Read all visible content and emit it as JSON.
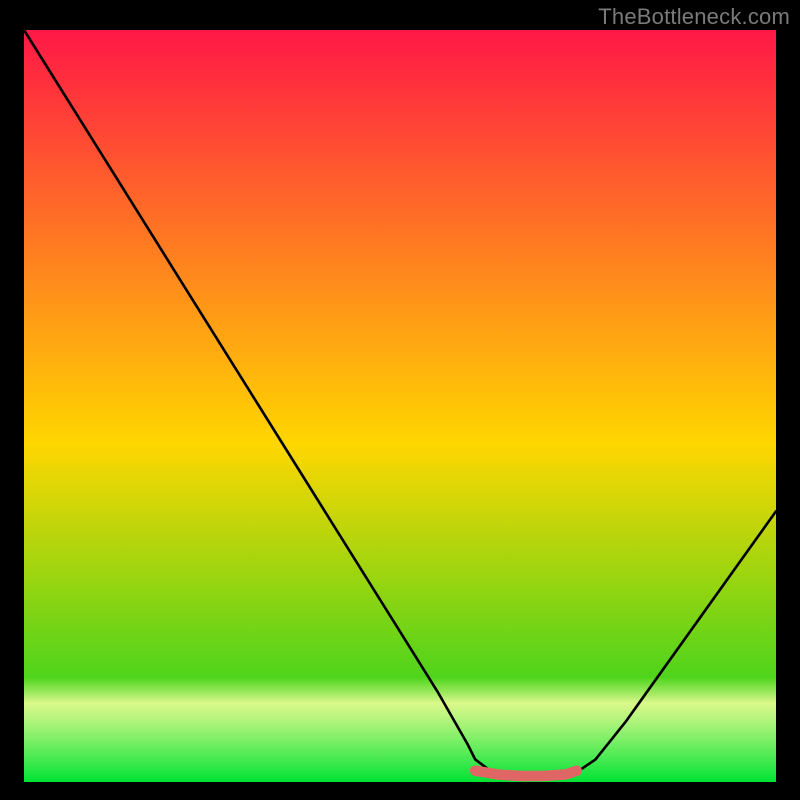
{
  "watermark": "TheBottleneck.com",
  "chart_data": {
    "type": "line",
    "title": "",
    "xlabel": "",
    "ylabel": "",
    "xlim": [
      0,
      100
    ],
    "ylim": [
      0,
      100
    ],
    "series": [
      {
        "name": "bottleneck-curve",
        "x": [
          0,
          5,
          10,
          15,
          20,
          25,
          30,
          35,
          40,
          45,
          50,
          55,
          59,
          60,
          62,
          65,
          68,
          71,
          73.5,
          76,
          80,
          85,
          90,
          95,
          100
        ],
        "values": [
          100,
          92,
          84,
          76,
          68,
          60,
          52,
          44,
          36,
          28,
          20,
          12,
          5,
          3,
          1.5,
          0.8,
          0.6,
          0.7,
          1.3,
          3,
          8,
          15,
          22,
          29,
          36
        ]
      },
      {
        "name": "optimal-segment",
        "x": [
          60,
          63,
          66,
          69,
          72,
          73.5
        ],
        "values": [
          1.5,
          1.0,
          0.8,
          0.8,
          1.0,
          1.5
        ]
      }
    ],
    "colors": {
      "curve": "#000000",
      "optimal": "#e06666",
      "gradient_top": "#ff1846",
      "gradient_mid": "#ffd600",
      "gradient_bottom": "#00d328",
      "good_band_top": "#f7ff9e",
      "good_band_bottom": "#00e234"
    }
  }
}
